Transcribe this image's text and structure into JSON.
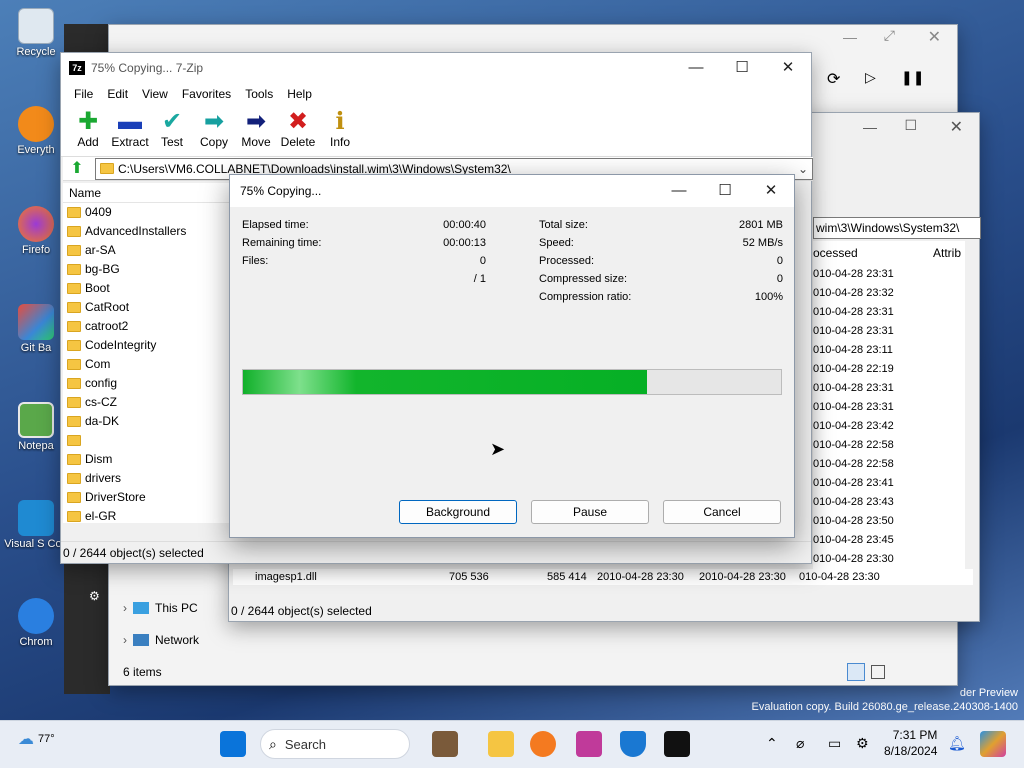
{
  "desktop": {
    "icons": [
      {
        "label": "Recycle"
      },
      {
        "label": "Everyth"
      },
      {
        "label": "Firefo"
      },
      {
        "label": "Git Ba"
      },
      {
        "label": "Notepa"
      },
      {
        "label": "Visual S Cod"
      },
      {
        "label": "Chrom"
      }
    ],
    "watermark_line1": "der Preview",
    "watermark_line2": "Evaluation copy. Build 26080.ge_release.240308-1400"
  },
  "explorer_back": {
    "status": "6 items",
    "nav": [
      {
        "label": "This PC"
      },
      {
        "label": "Network"
      }
    ]
  },
  "sevenzip_back": {
    "path": "wim\\3\\Windows\\System32\\",
    "col_processed": "ocessed",
    "col_attrib": "Attrib",
    "dates": [
      "010-04-28 23:31",
      "010-04-28 23:32",
      "010-04-28 23:31",
      "010-04-28 23:31",
      "010-04-28 23:11",
      "010-04-28 22:19",
      "010-04-28 23:31",
      "010-04-28 23:31",
      "010-04-28 23:42",
      "010-04-28 22:58",
      "010-04-28 22:58",
      "010-04-28 23:41",
      "010-04-28 23:43",
      "010-04-28 23:50",
      "010-04-28 23:45",
      "010-04-28 23:30",
      "010-04-28 23:30"
    ],
    "bottom_file": "imagesp1.dll",
    "bottom_size": "705 536",
    "bottom_packed": "585 414",
    "bottom_mod": "2010-04-28 23:30",
    "bottom_mod2": "2010-04-28 23:30",
    "status": "0 / 2644 object(s) selected"
  },
  "sevenzip": {
    "title": "75% Copying... 7-Zip",
    "menu": [
      "File",
      "Edit",
      "View",
      "Favorites",
      "Tools",
      "Help"
    ],
    "tools": [
      {
        "label": "Add",
        "glyph": "✚",
        "color": "#1aa832"
      },
      {
        "label": "Extract",
        "glyph": "▬",
        "color": "#1a3fb8"
      },
      {
        "label": "Test",
        "glyph": "✔",
        "color": "#1aa8a0"
      },
      {
        "label": "Copy",
        "glyph": "➡",
        "color": "#16a0a0"
      },
      {
        "label": "Move",
        "glyph": "➡",
        "color": "#12207a"
      },
      {
        "label": "Delete",
        "glyph": "✖",
        "color": "#d21e1e"
      },
      {
        "label": "Info",
        "glyph": "ℹ",
        "color": "#c09010"
      }
    ],
    "path": "C:\\Users\\VM6.COLLABNET\\Downloads\\install.wim\\3\\Windows\\System32\\",
    "col_name": "Name",
    "folders": [
      "0409",
      "AdvancedInstallers",
      "ar-SA",
      "bg-BG",
      "Boot",
      "CatRoot",
      "catroot2",
      "CodeIntegrity",
      "Com",
      "config",
      "cs-CZ",
      "da-DK",
      "",
      "Dism",
      "drivers",
      "DriverStore",
      "el-GR"
    ],
    "status": "0 / 2644 object(s) selected"
  },
  "dialog": {
    "title": "75% Copying...",
    "elapsed_label": "Elapsed time:",
    "elapsed": "00:00:40",
    "remaining_label": "Remaining time:",
    "remaining": "00:00:13",
    "files_label": "Files:",
    "files": "0",
    "files_total": "/ 1",
    "total_size_label": "Total size:",
    "total_size": "2801 MB",
    "speed_label": "Speed:",
    "speed": "52 MB/s",
    "processed_label": "Processed:",
    "processed": "0",
    "compressed_label": "Compressed size:",
    "compressed": "0",
    "ratio_label": "Compression ratio:",
    "ratio": "100%",
    "progress": 0.75,
    "btn_background": "Background",
    "btn_pause": "Pause",
    "btn_cancel": "Cancel"
  },
  "taskbar": {
    "weather": "77°",
    "search": "Search",
    "time": "7:31 PM",
    "date": "8/18/2024"
  }
}
